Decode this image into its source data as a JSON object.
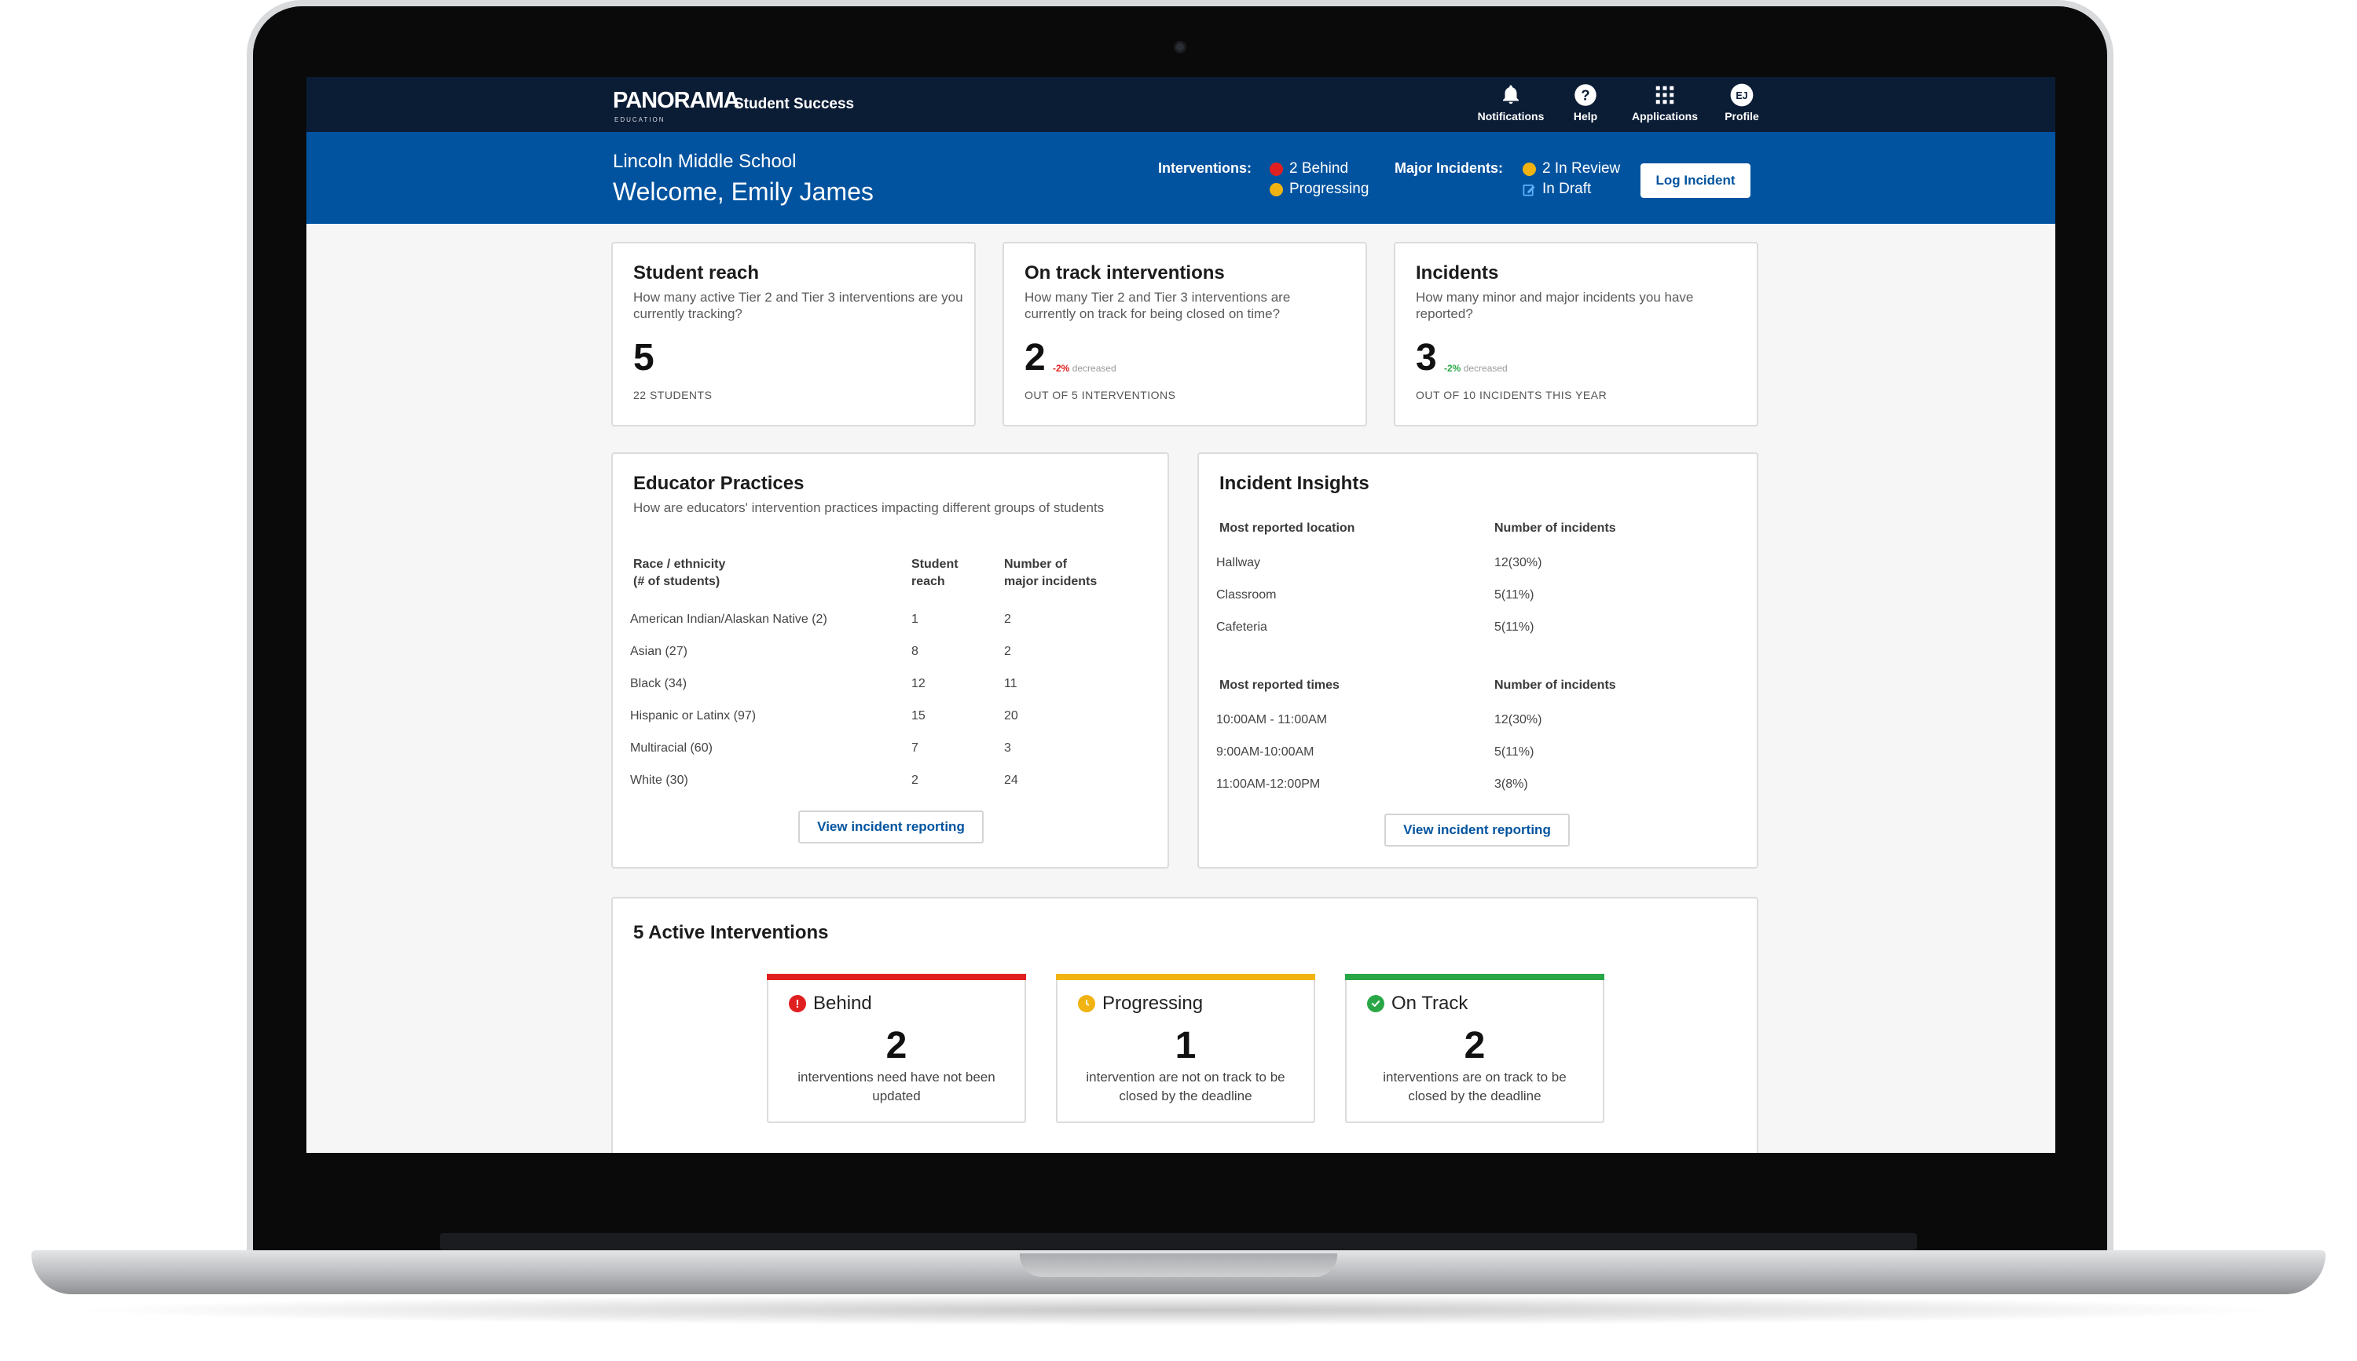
{
  "colors": {
    "navy": "#0b1c35",
    "brand_blue": "#02539f",
    "behind_red": "#e02020",
    "progressing_yellow": "#f0b312",
    "on_track_green": "#29a746"
  },
  "app": {
    "logo": "PANORAMA",
    "logo_sub": "EDUCATION",
    "product": "Student Success"
  },
  "nav": [
    {
      "label": "Notifications",
      "icon": "bell-icon"
    },
    {
      "label": "Help",
      "icon": "help-icon"
    },
    {
      "label": "Applications",
      "icon": "apps-grid-icon"
    },
    {
      "label": "Profile",
      "icon": "avatar",
      "initials": "EJ"
    }
  ],
  "banner": {
    "school": "Lincoln Middle School",
    "welcome": "Welcome, Emily James",
    "interventions_label": "Interventions:",
    "interventions": [
      {
        "text": "2 Behind",
        "status": "behind"
      },
      {
        "text": "Progressing",
        "status": "progressing"
      }
    ],
    "incidents_label": "Major Incidents:",
    "incidents": [
      {
        "text": "2 In Review",
        "status": "review"
      },
      {
        "text": "In Draft",
        "status": "draft"
      }
    ],
    "log_button": "Log Incident"
  },
  "stats": [
    {
      "title": "Student reach",
      "desc": "How many active Tier 2 and Tier 3 interventions are you currently tracking?",
      "value": "5",
      "delta": "",
      "delta_word": "",
      "caption": "22 STUDENTS"
    },
    {
      "title": "On track interventions",
      "desc": "How many Tier 2 and Tier 3 interventions are currently on track for being closed on time?",
      "value": "2",
      "delta": "-2%",
      "delta_word": "decreased",
      "delta_color": "#e02020",
      "caption": "OUT OF 5 INTERVENTIONS"
    },
    {
      "title": "Incidents",
      "desc": "How many minor and major incidents you have reported?",
      "value": "3",
      "delta": "-2%",
      "delta_word": "decreased",
      "delta_color": "#29a746",
      "caption": "OUT OF 10 INCIDENTS THIS YEAR"
    }
  ],
  "educator": {
    "title": "Educator Practices",
    "desc": "How are educators' intervention practices impacting different groups of students",
    "headers": [
      "Race / ethnicity\n(# of students)",
      "Student\nreach",
      "Number of\nmajor incidents"
    ],
    "rows": [
      [
        "American Indian/Alaskan Native (2)",
        "1",
        "2"
      ],
      [
        "Asian (27)",
        "8",
        "2"
      ],
      [
        "Black (34)",
        "12",
        "11"
      ],
      [
        "Hispanic or Latinx (97)",
        "15",
        "20"
      ],
      [
        "Multiracial (60)",
        "7",
        "3"
      ],
      [
        "White (30)",
        "2",
        "24"
      ]
    ],
    "button": "View incident reporting"
  },
  "insights": {
    "title": "Incident Insights",
    "locations_headers": [
      "Most reported location",
      "Number of incidents"
    ],
    "locations": [
      [
        "Hallway",
        "12(30%)"
      ],
      [
        "Classroom",
        "5(11%)"
      ],
      [
        "Cafeteria",
        "5(11%)"
      ]
    ],
    "times_headers": [
      "Most reported times",
      "Number of incidents"
    ],
    "times": [
      [
        "10:00AM - 11:00AM",
        "12(30%)"
      ],
      [
        "9:00AM-10:00AM",
        "5(11%)"
      ],
      [
        "11:00AM-12:00PM",
        "3(8%)"
      ]
    ],
    "button": "View incident reporting"
  },
  "active": {
    "title": "5 Active Interventions",
    "cards": [
      {
        "label": "Behind",
        "value": "2",
        "text": "interventions need have not been updated",
        "status": "behind"
      },
      {
        "label": "Progressing",
        "value": "1",
        "text": "intervention are not on track to be closed by the deadline",
        "status": "progressing"
      },
      {
        "label": "On Track",
        "value": "2",
        "text": "interventions are on track to be closed by the deadline",
        "status": "on-track"
      }
    ]
  }
}
